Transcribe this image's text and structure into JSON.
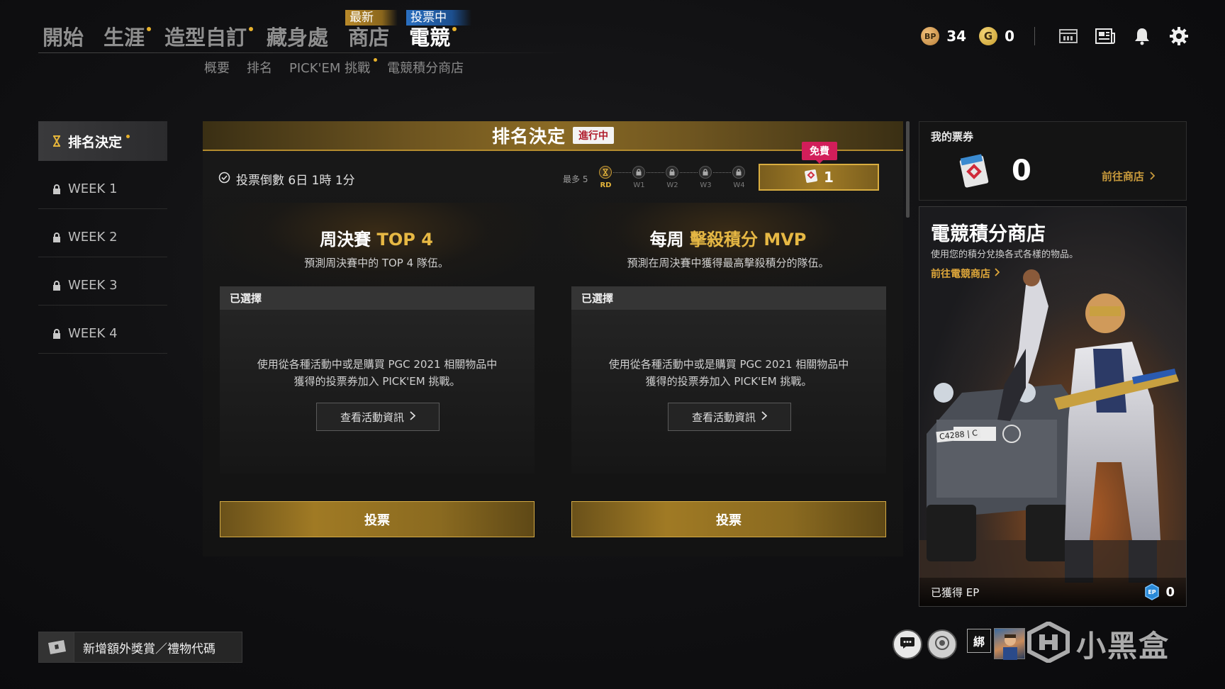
{
  "nav": {
    "items": [
      {
        "label": "開始",
        "dot": false,
        "tag": ""
      },
      {
        "label": "生涯",
        "dot": true,
        "tag": ""
      },
      {
        "label": "造型自訂",
        "dot": true,
        "tag": ""
      },
      {
        "label": "藏身處",
        "dot": false,
        "tag": ""
      },
      {
        "label": "商店",
        "dot": false,
        "tag": "最新"
      },
      {
        "label": "電競",
        "dot": true,
        "tag": "投票中",
        "active": true
      }
    ],
    "sub": [
      {
        "label": "概要"
      },
      {
        "label": "排名"
      },
      {
        "label": "PICK'EM 挑戰",
        "active": true,
        "dot": true
      },
      {
        "label": "電競積分商店"
      }
    ]
  },
  "currency": {
    "bp_icon": "BP",
    "bp_value": "34",
    "g_icon": "G",
    "g_value": "0",
    "icons": [
      "stats-icon",
      "news-icon",
      "bell-icon",
      "gear-icon"
    ]
  },
  "sidebar": {
    "items": [
      {
        "label": "排名決定",
        "icon": "hourglass-icon",
        "active": true,
        "dot": true
      },
      {
        "label": "WEEK 1",
        "icon": "lock-icon"
      },
      {
        "label": "WEEK 2",
        "icon": "lock-icon"
      },
      {
        "label": "WEEK 3",
        "icon": "lock-icon"
      },
      {
        "label": "WEEK 4",
        "icon": "lock-icon"
      }
    ]
  },
  "main": {
    "title": "排名決定",
    "status": "進行中",
    "countdown": "投票倒數 6日 1時 1分",
    "max_label": "最多 5",
    "steps": [
      "RD",
      "W1",
      "W2",
      "W3",
      "W4"
    ],
    "free_tag": "免費",
    "ticket_count": "1",
    "cards": [
      {
        "title_a": "周決賽 ",
        "title_b": "TOP 4",
        "desc": "預測周決賽中的 TOP 4 隊伍。",
        "selected_label": "已選擇",
        "body_line1": "使用從各種活動中或是購買 PGC 2021 相關物品中",
        "body_line2": "獲得的投票券加入 PICK'EM 挑戰。",
        "info_button": "查看活動資訊",
        "vote_button": "投票"
      },
      {
        "title_a": "每周 ",
        "title_b": "擊殺積分 MVP",
        "desc": "預測在周決賽中獲得最高擊殺積分的隊伍。",
        "selected_label": "已選擇",
        "body_line1": "使用從各種活動中或是購買 PGC 2021 相關物品中",
        "body_line2": "獲得的投票券加入 PICK'EM 挑戰。",
        "info_button": "查看活動資訊",
        "vote_button": "投票"
      }
    ]
  },
  "tickets": {
    "title": "我的票券",
    "count": "0",
    "link": "前往商店"
  },
  "shop": {
    "title": "電競積分商店",
    "desc": "使用您的積分兌換各式各樣的物品。",
    "link": "前往電競商店",
    "ep_label": "已獲得 EP",
    "ep_icon": "EP",
    "ep_value": "0",
    "plate": "C4288 | C"
  },
  "bottom": {
    "redeem": "新增額外獎賞／禮物代碼",
    "bind": "綁",
    "watermark": "小黑盒"
  },
  "colors": {
    "accent_gold": "#e6b844",
    "status_red": "#b01c2c",
    "free_pink": "#d21e5a",
    "voting_blue": "#2a6fc0"
  }
}
